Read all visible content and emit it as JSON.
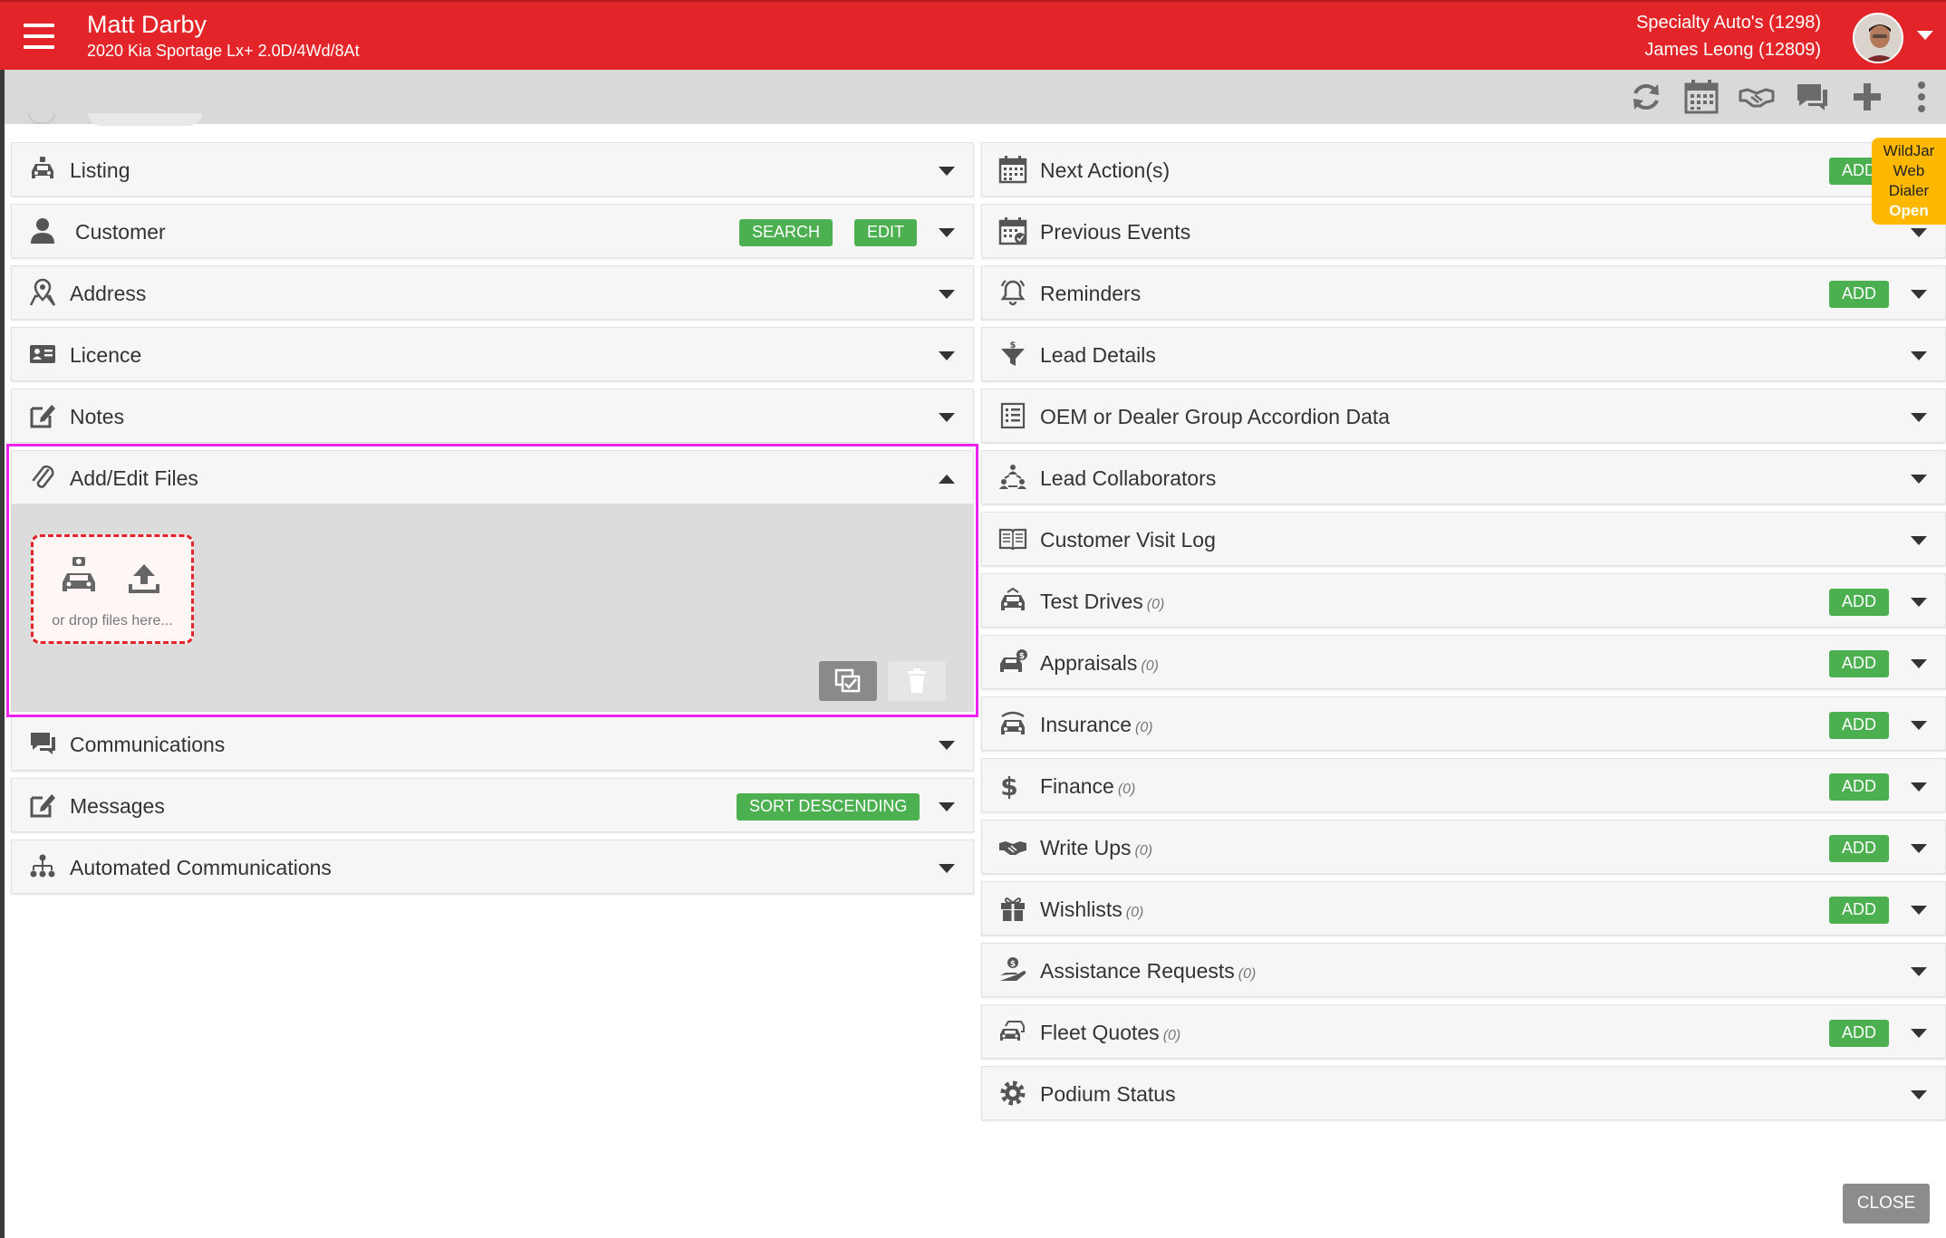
{
  "header": {
    "name": "Matt Darby",
    "vehicle": "2020 Kia Sportage Lx+ 2.0D/4Wd/8At",
    "dealer": "Specialty Auto's (1298)",
    "user": "James Leong (12809)"
  },
  "toolbar": {
    "icons": [
      "refresh-icon",
      "calendar-icon",
      "handshake-icon",
      "chat-icon",
      "plus-icon",
      "kebab-menu-icon"
    ]
  },
  "left_panels": [
    {
      "title": "Listing",
      "icon": "car-icon"
    },
    {
      "title": "Customer",
      "icon": "person-icon",
      "buttons": [
        "SEARCH",
        "EDIT"
      ]
    },
    {
      "title": "Address",
      "icon": "map-pin-icon"
    },
    {
      "title": "Licence",
      "icon": "id-card-icon"
    },
    {
      "title": "Notes",
      "icon": "edit-note-icon"
    },
    {
      "title": "Add/Edit Files",
      "icon": "paperclip-icon",
      "expanded": true
    },
    {
      "title": "Communications",
      "icon": "chat-icon"
    },
    {
      "title": "Messages",
      "icon": "edit-note-icon",
      "buttons": [
        "SORT DESCENDING"
      ]
    },
    {
      "title": "Automated Communications",
      "icon": "sitemap-icon"
    }
  ],
  "files": {
    "drop_text": "or drop files here..."
  },
  "right_panels": [
    {
      "title": "Next Action(s)",
      "icon": "calendar-icon",
      "add": "ADD"
    },
    {
      "title": "Previous Events",
      "icon": "calendar-check-icon"
    },
    {
      "title": "Reminders",
      "icon": "bell-icon",
      "add": "ADD"
    },
    {
      "title": "Lead Details",
      "icon": "funnel-dollar-icon"
    },
    {
      "title": "OEM or Dealer Group Accordion Data",
      "icon": "list-icon"
    },
    {
      "title": "Lead Collaborators",
      "icon": "collaborators-icon"
    },
    {
      "title": "Customer Visit Log",
      "icon": "book-icon"
    },
    {
      "title": "Test Drives",
      "count": "(0)",
      "icon": "car-icon",
      "add": "ADD"
    },
    {
      "title": "Appraisals",
      "count": "(0)",
      "icon": "car-dollar-icon",
      "add": "ADD"
    },
    {
      "title": "Insurance",
      "count": "(0)",
      "icon": "car-shield-icon",
      "add": "ADD"
    },
    {
      "title": "Finance",
      "count": "(0)",
      "icon": "dollar-icon",
      "add": "ADD"
    },
    {
      "title": "Write Ups",
      "count": "(0)",
      "icon": "handshake-icon",
      "add": "ADD"
    },
    {
      "title": "Wishlists",
      "count": "(0)",
      "icon": "gift-icon",
      "add": "ADD"
    },
    {
      "title": "Assistance Requests",
      "count": "(0)",
      "icon": "helping-hand-icon"
    },
    {
      "title": "Fleet Quotes",
      "count": "(0)",
      "icon": "cars-icon",
      "add": "ADD"
    },
    {
      "title": "Podium Status",
      "icon": "gear-icon"
    }
  ],
  "wildjar": {
    "line1": "WildJar",
    "line2": "Web",
    "line3": "Dialer",
    "status": "Open"
  },
  "close_label": "CLOSE",
  "colors": {
    "brand_red": "#e32428",
    "add_green": "#4caf50",
    "highlight_magenta": "#ee22ee",
    "wildjar_orange": "#ffb800"
  }
}
